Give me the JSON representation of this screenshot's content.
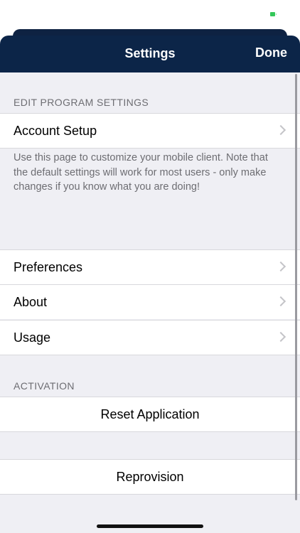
{
  "nav": {
    "title": "Settings",
    "done_label": "Done"
  },
  "sections": {
    "program": {
      "header": "EDIT PROGRAM SETTINGS",
      "account_setup": "Account Setup",
      "description": "Use this page to customize your mobile client. Note that the default settings will work for most users - only make changes if you know what you are doing!"
    },
    "general": {
      "items": [
        "Preferences",
        "About",
        "Usage"
      ]
    },
    "activation": {
      "header": "ACTIVATION",
      "reset": "Reset Application",
      "reprovision": "Reprovision"
    }
  },
  "colors": {
    "nav_background": "#0c2548",
    "page_background": "#efeff4",
    "battery": "#34c759"
  }
}
